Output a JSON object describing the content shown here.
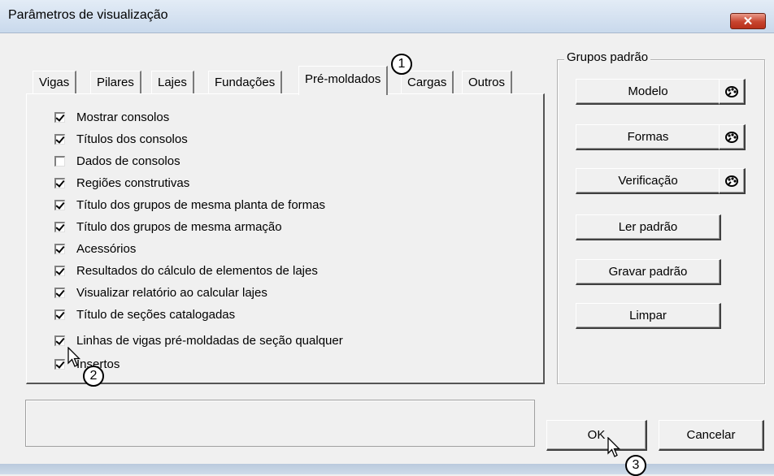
{
  "window": {
    "title": "Parâmetros de visualização",
    "close_glyph": "✕"
  },
  "tabs": [
    {
      "label": "Vigas"
    },
    {
      "label": "Pilares"
    },
    {
      "label": "Lajes"
    },
    {
      "label": "Fundações"
    },
    {
      "label": "Pré-moldados",
      "active": true
    },
    {
      "label": "Cargas"
    },
    {
      "label": "Outros"
    }
  ],
  "options": [
    {
      "label": "Mostrar consolos",
      "checked": true
    },
    {
      "label": "Títulos dos consolos",
      "checked": true
    },
    {
      "label": "Dados de consolos",
      "checked": false
    },
    {
      "label": "Regiões construtivas",
      "checked": true
    },
    {
      "label": "Título dos grupos de mesma planta de formas",
      "checked": true
    },
    {
      "label": "Título dos grupos de mesma armação",
      "checked": true
    },
    {
      "label": "Acessórios",
      "checked": true
    },
    {
      "label": "Resultados do cálculo de elementos de lajes",
      "checked": true
    },
    {
      "label": "Visualizar relatório ao calcular lajes",
      "checked": true
    },
    {
      "label": "Título de seções catalogadas",
      "checked": true
    },
    {
      "label": "Linhas de vigas pré-moldadas  de seção qualquer",
      "checked": true
    },
    {
      "label": "Insertos",
      "checked": true
    }
  ],
  "groups": {
    "legend": "Grupos padrão",
    "modelo": "Modelo",
    "formas": "Formas",
    "verificacao": "Verificação",
    "ler": "Ler padrão",
    "gravar": "Gravar padrão",
    "limpar": "Limpar",
    "icon": "palette-icon"
  },
  "footer": {
    "ok": "OK",
    "cancel": "Cancelar"
  },
  "annotations": [
    "1",
    "2",
    "3"
  ],
  "colors": {
    "close_button": "#c7442e",
    "title_gradient_top": "#e3ecf6"
  }
}
